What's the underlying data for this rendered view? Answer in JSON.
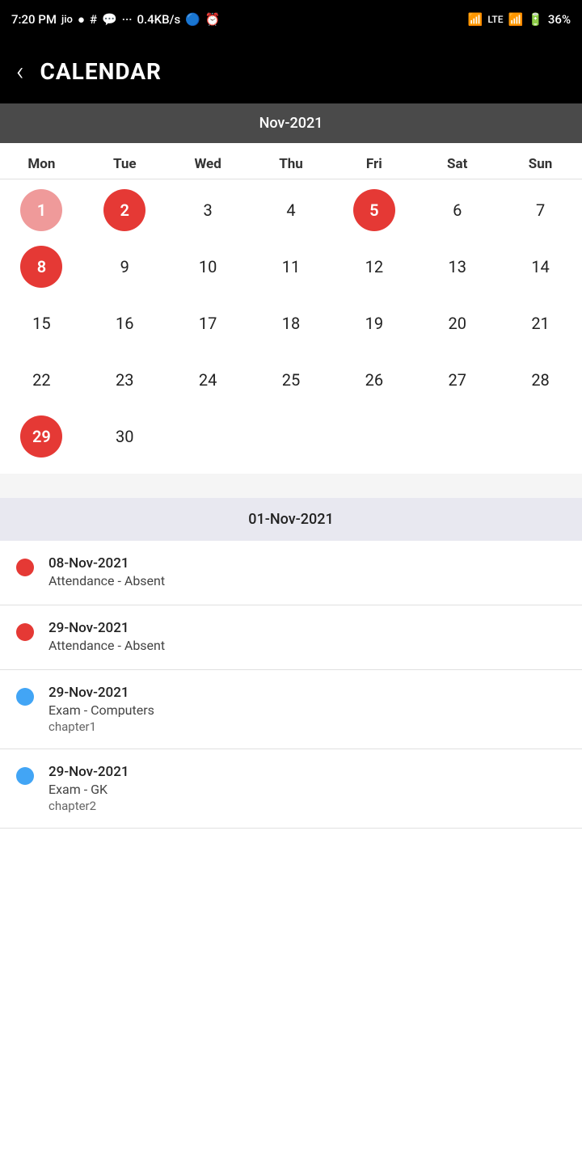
{
  "statusBar": {
    "time": "7:20 PM",
    "network": "0.4KB/s",
    "battery": "36%"
  },
  "header": {
    "back_label": "‹",
    "title": "CALENDAR"
  },
  "calendar": {
    "month_label": "Nov-2021",
    "weekdays": [
      "Mon",
      "Tue",
      "Wed",
      "Thu",
      "Fri",
      "Sat",
      "Sun"
    ],
    "days": [
      {
        "day": "1",
        "style": "red-light",
        "col": 1
      },
      {
        "day": "2",
        "style": "red",
        "col": 2
      },
      {
        "day": "3",
        "style": "none",
        "col": 3
      },
      {
        "day": "4",
        "style": "none",
        "col": 4
      },
      {
        "day": "5",
        "style": "red",
        "col": 5
      },
      {
        "day": "6",
        "style": "none",
        "col": 6
      },
      {
        "day": "7",
        "style": "none",
        "col": 7
      },
      {
        "day": "8",
        "style": "red",
        "col": 1
      },
      {
        "day": "9",
        "style": "none",
        "col": 2
      },
      {
        "day": "10",
        "style": "none",
        "col": 3
      },
      {
        "day": "11",
        "style": "none",
        "col": 4
      },
      {
        "day": "12",
        "style": "none",
        "col": 5
      },
      {
        "day": "13",
        "style": "none",
        "col": 6
      },
      {
        "day": "14",
        "style": "none",
        "col": 7
      },
      {
        "day": "15",
        "style": "none",
        "col": 1
      },
      {
        "day": "16",
        "style": "none",
        "col": 2
      },
      {
        "day": "17",
        "style": "none",
        "col": 3
      },
      {
        "day": "18",
        "style": "none",
        "col": 4
      },
      {
        "day": "19",
        "style": "none",
        "col": 5
      },
      {
        "day": "20",
        "style": "none",
        "col": 6
      },
      {
        "day": "21",
        "style": "none",
        "col": 7
      },
      {
        "day": "22",
        "style": "none",
        "col": 1
      },
      {
        "day": "23",
        "style": "none",
        "col": 2
      },
      {
        "day": "24",
        "style": "none",
        "col": 3
      },
      {
        "day": "25",
        "style": "none",
        "col": 4
      },
      {
        "day": "26",
        "style": "none",
        "col": 5
      },
      {
        "day": "27",
        "style": "none",
        "col": 6
      },
      {
        "day": "28",
        "style": "none",
        "col": 7
      },
      {
        "day": "29",
        "style": "red",
        "col": 1
      },
      {
        "day": "30",
        "style": "none",
        "col": 2
      }
    ]
  },
  "events": {
    "date_header": "01-Nov-2021",
    "items": [
      {
        "dot": "red",
        "date": "08-Nov-2021",
        "title": "Attendance - Absent",
        "subtitle": ""
      },
      {
        "dot": "red",
        "date": "29-Nov-2021",
        "title": "Attendance - Absent",
        "subtitle": ""
      },
      {
        "dot": "blue",
        "date": "29-Nov-2021",
        "title": "Exam - Computers",
        "subtitle": "chapter1"
      },
      {
        "dot": "blue",
        "date": "29-Nov-2021",
        "title": "Exam - GK",
        "subtitle": "chapter2"
      }
    ]
  }
}
